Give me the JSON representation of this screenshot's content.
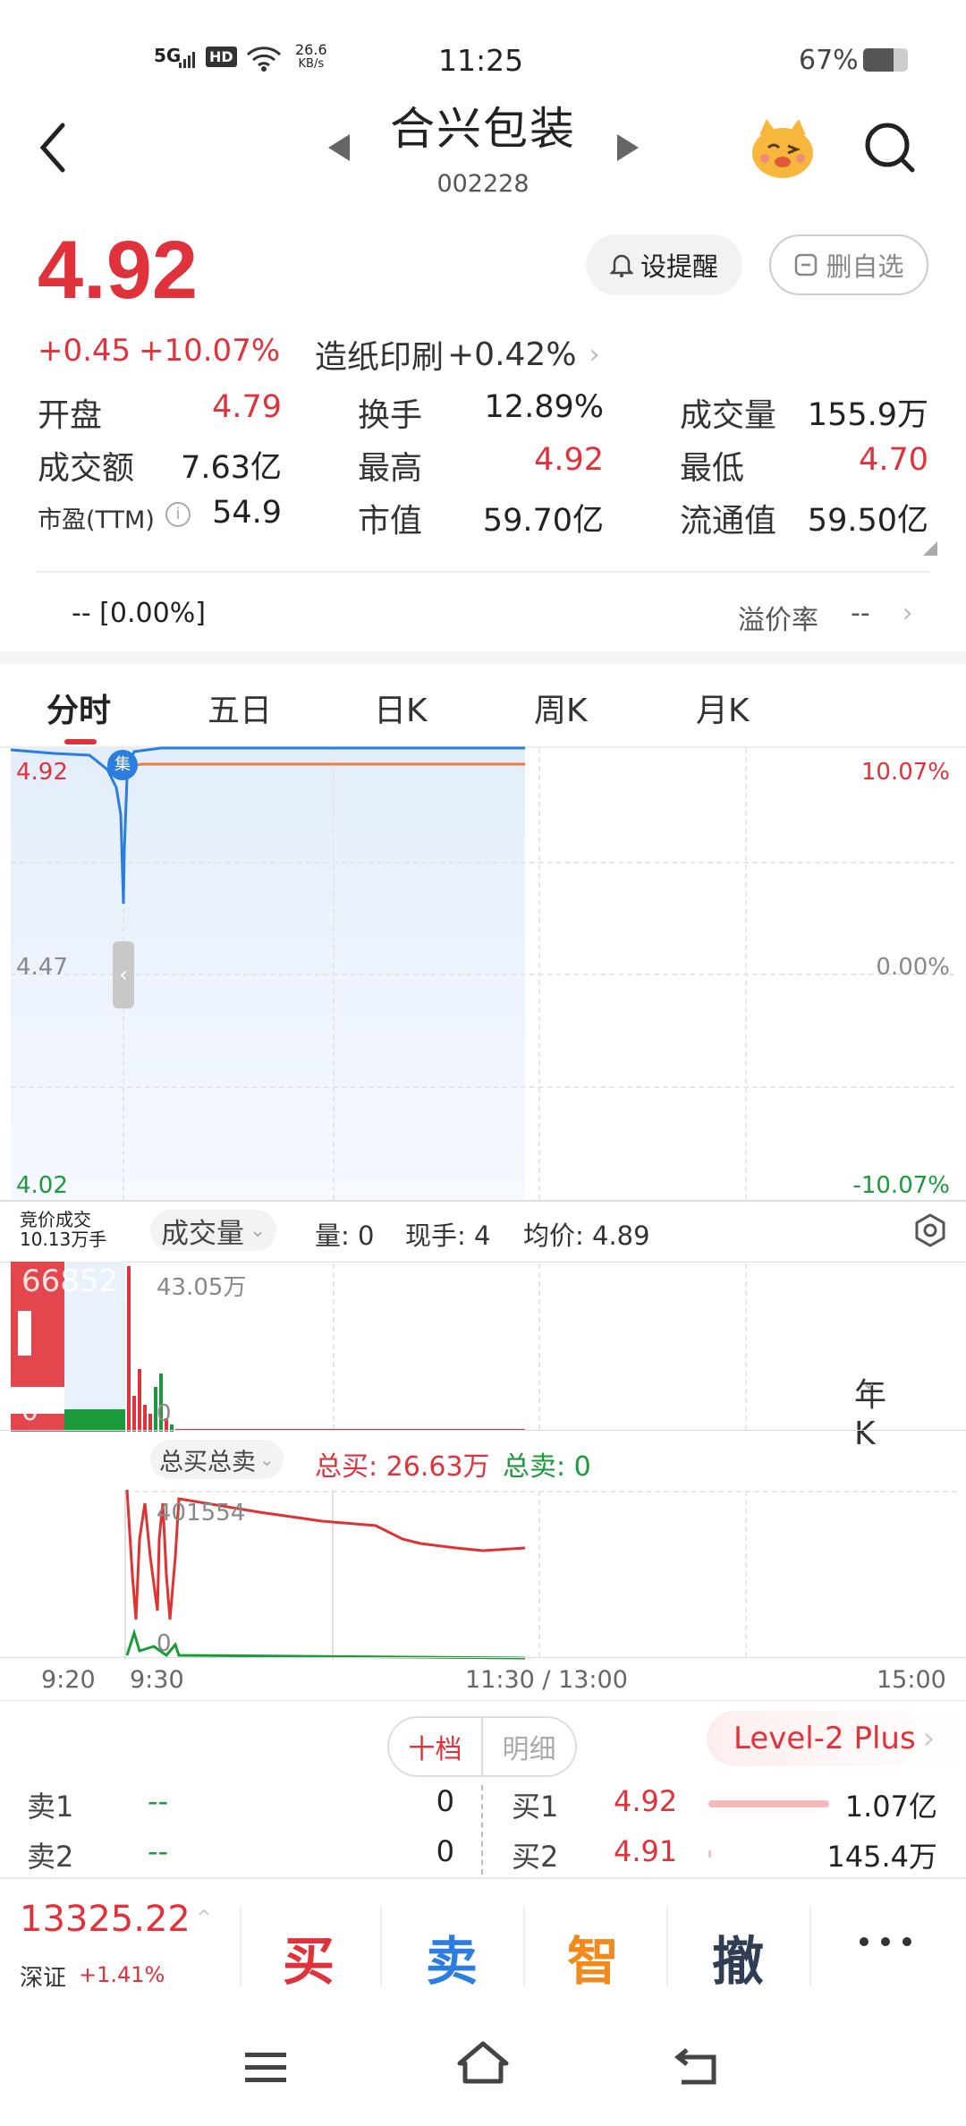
{
  "status_bar": {
    "network": "5G",
    "hd": "HD",
    "speed_value": "26.6",
    "speed_unit": "KB/s",
    "time": "11:25",
    "battery": "67%"
  },
  "header": {
    "title": "合兴包装",
    "code": "002228"
  },
  "quote": {
    "price": "4.92",
    "change": "+0.45",
    "change_pct": "+10.07%",
    "sector": "造纸印刷",
    "sector_pct": "+0.42%",
    "alert_btn": "设提醒",
    "watch_btn": "删自选"
  },
  "stats": [
    {
      "label": "开盘",
      "value": "4.79",
      "color": "red"
    },
    {
      "label": "换手",
      "value": "12.89%",
      "color": "dark"
    },
    {
      "label": "成交量",
      "value": "155.9万",
      "color": "dark"
    },
    {
      "label": "成交额",
      "value": "7.63亿",
      "color": "dark"
    },
    {
      "label": "最高",
      "value": "4.92",
      "color": "red"
    },
    {
      "label": "最低",
      "value": "4.70",
      "color": "red"
    },
    {
      "label": "市盈(TTM)",
      "value": "54.9",
      "color": "dark"
    },
    {
      "label": "市值",
      "value": "59.70亿",
      "color": "dark"
    },
    {
      "label": "流通值",
      "value": "59.50亿",
      "color": "dark"
    }
  ],
  "premium": {
    "left": "--  [0.00%]",
    "label": "溢价率",
    "value": "--"
  },
  "tabs": [
    "分时",
    "五日",
    "日K",
    "周K",
    "月K",
    "年K"
  ],
  "chart": {
    "y_top": "4.92",
    "y_mid": "4.47",
    "y_bot": "4.02",
    "pct_top": "10.07%",
    "pct_mid": "0.00%",
    "pct_bot": "-10.07%",
    "badge": "集"
  },
  "volume": {
    "auction_line1": "竞价成交",
    "auction_line2": "10.13万手",
    "selector": "成交量",
    "vol": "量: 0",
    "hand": "现手: 4",
    "avg": "均价: 4.89",
    "auction_max": "66852",
    "auction_min": "0",
    "max_label": "43.05万",
    "min_label": "0"
  },
  "bidask": {
    "selector": "总买总卖",
    "buy": "总买: 26.63万",
    "sell": "总卖: 0",
    "max_label": "401554",
    "min_label": "0"
  },
  "time_axis": [
    "9:20",
    "9:30",
    "11:30 / 13:00",
    "15:00"
  ],
  "depth_tabs": {
    "ten": "十档",
    "detail": "明细",
    "level2": "Level-2 Plus"
  },
  "orderbook": {
    "sells": [
      {
        "label": "卖1",
        "price": "--",
        "qty": "0"
      },
      {
        "label": "卖2",
        "price": "--",
        "qty": "0"
      }
    ],
    "buys": [
      {
        "label": "买1",
        "price": "4.92",
        "qty": "1.07亿"
      },
      {
        "label": "买2",
        "price": "4.91",
        "qty": "145.4万"
      }
    ]
  },
  "index": {
    "value": "13325.22",
    "name": "深证",
    "pct": "+1.41%"
  },
  "actions": [
    "买",
    "卖",
    "智",
    "撤"
  ],
  "colors": {
    "up": "#e0323a",
    "down": "#1a9a3a",
    "line": "#2b7de0",
    "avg": "#f07c3c",
    "accent": "#2b7de0"
  }
}
